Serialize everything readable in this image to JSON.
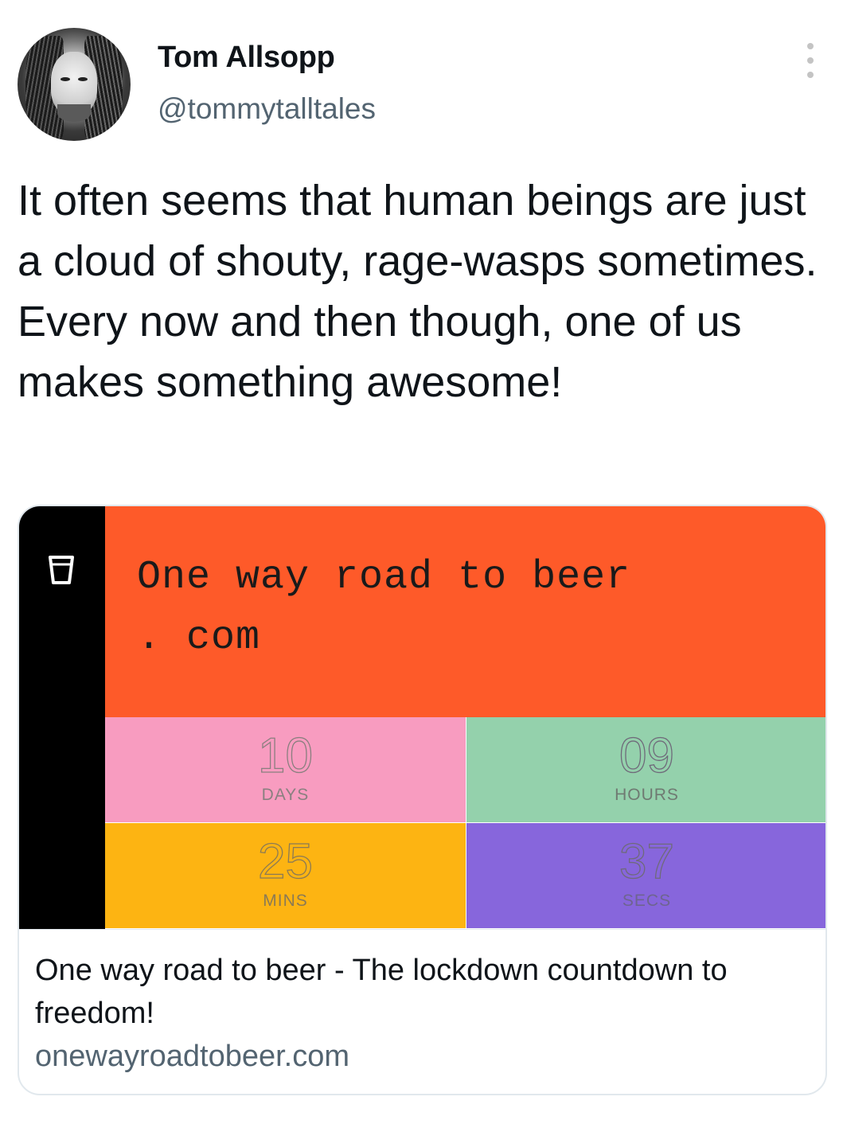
{
  "author": {
    "name": "Tom Allsopp",
    "handle": "@tommytalltales"
  },
  "tweet": {
    "text": "It often seems that human beings are just a cloud of shouty, rage-wasps sometimes. Every now and then though, one of us makes something awesome!"
  },
  "card": {
    "banner_line1": "One way road to beer",
    "banner_line2": ". com",
    "countdown": [
      {
        "value": "10",
        "unit": "DAYS",
        "color": "#f89cc0"
      },
      {
        "value": "09",
        "unit": "HOURS",
        "color": "#94d1ac"
      },
      {
        "value": "25",
        "unit": "MINS",
        "color": "#fdb412"
      },
      {
        "value": "37",
        "unit": "SECS",
        "color": "#8766dc"
      }
    ],
    "title": "One way road to beer - The lockdown countdown to freedom!",
    "url": "onewayroadtobeer.com",
    "banner_color": "#fe5a29"
  },
  "icons": {
    "more": "more-vertical-icon",
    "glass": "beer-glass-icon"
  }
}
